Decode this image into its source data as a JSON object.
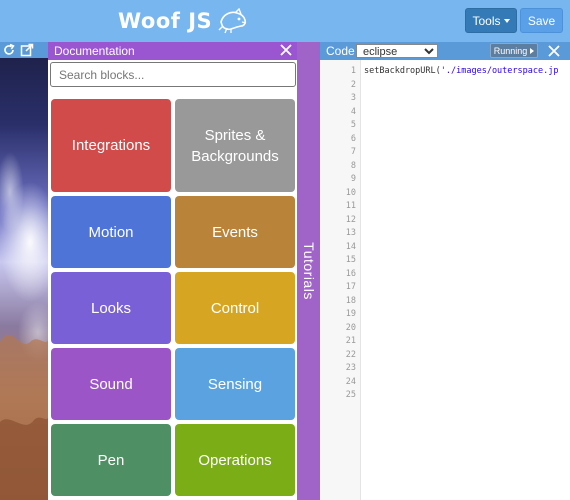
{
  "header": {
    "logo_text": "Woof JS",
    "tools_label": "Tools",
    "save_label": "Save"
  },
  "docs": {
    "title": "Documentation",
    "search_placeholder": "Search blocks...",
    "categories": [
      {
        "label": "Integrations",
        "color": "#d24b4b"
      },
      {
        "label": "Sprites & Backgrounds",
        "color": "#999999"
      },
      {
        "label": "Motion",
        "color": "#4e74d8"
      },
      {
        "label": "Events",
        "color": "#b9843a"
      },
      {
        "label": "Looks",
        "color": "#7a60d6"
      },
      {
        "label": "Control",
        "color": "#d6a623"
      },
      {
        "label": "Sound",
        "color": "#9b55c6"
      },
      {
        "label": "Sensing",
        "color": "#5aa3e0"
      },
      {
        "label": "Pen",
        "color": "#4e8f63"
      },
      {
        "label": "Operations",
        "color": "#7aad16"
      }
    ]
  },
  "tutorials": {
    "label": "Tutorials"
  },
  "code": {
    "label": "Code",
    "theme": "eclipse",
    "status": "Running",
    "line_numbers": [
      "1",
      "2",
      "3",
      "4",
      "5",
      "6",
      "7",
      "8",
      "9",
      "10",
      "11",
      "12",
      "13",
      "14",
      "15",
      "16",
      "17",
      "18",
      "19",
      "20",
      "21",
      "22",
      "23",
      "24",
      "25"
    ],
    "line1_func": "setBackdropURL(",
    "line1_string": "'./images/outerspace.jp"
  },
  "icons": {
    "reload": "reload-icon",
    "popout": "popout-icon",
    "close": "close-icon"
  }
}
